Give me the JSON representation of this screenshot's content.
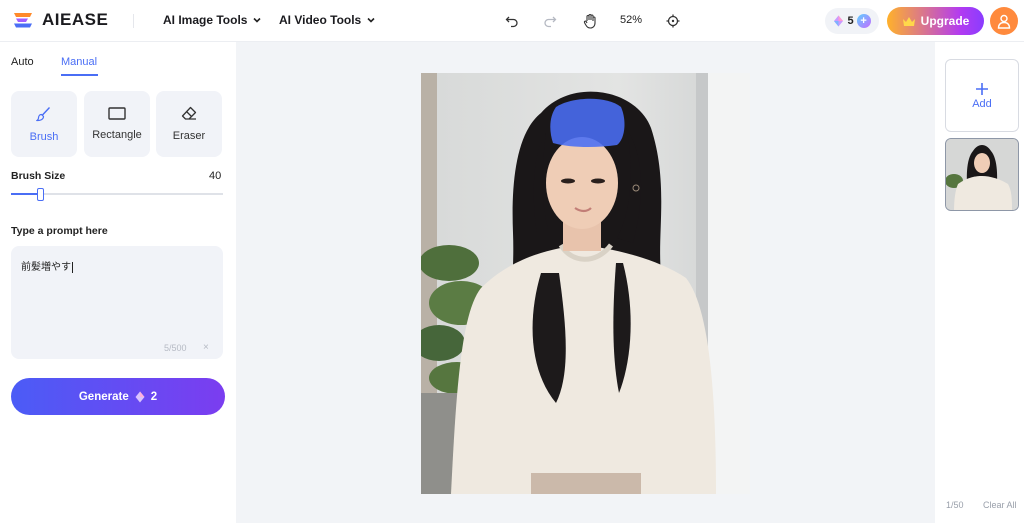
{
  "brand": {
    "name": "AIEASE"
  },
  "nav": {
    "image_tools": "AI Image Tools",
    "video_tools": "AI Video Tools"
  },
  "toolbar": {
    "zoom": "52%",
    "credits": "5",
    "upgrade": "Upgrade"
  },
  "modes": {
    "auto": "Auto",
    "manual": "Manual",
    "active": "Manual"
  },
  "tools": {
    "brush": "Brush",
    "rectangle": "Rectangle",
    "eraser": "Eraser",
    "active": "Brush"
  },
  "brush_size": {
    "label": "Brush Size",
    "value": "40",
    "level": 0.14
  },
  "prompt": {
    "label": "Type a prompt here",
    "value": "前髪増やす",
    "count": "5/500",
    "clear": "×"
  },
  "generate": {
    "label": "Generate",
    "cost": "2"
  },
  "sidebar": {
    "add": "Add",
    "page_count": "1/50",
    "clear_all": "Clear All"
  },
  "colors": {
    "accent": "#4a6ef5",
    "brush_mask": "#4a6ef5",
    "upgrade_start": "#ffb12b",
    "upgrade_end": "#8a3cff"
  }
}
